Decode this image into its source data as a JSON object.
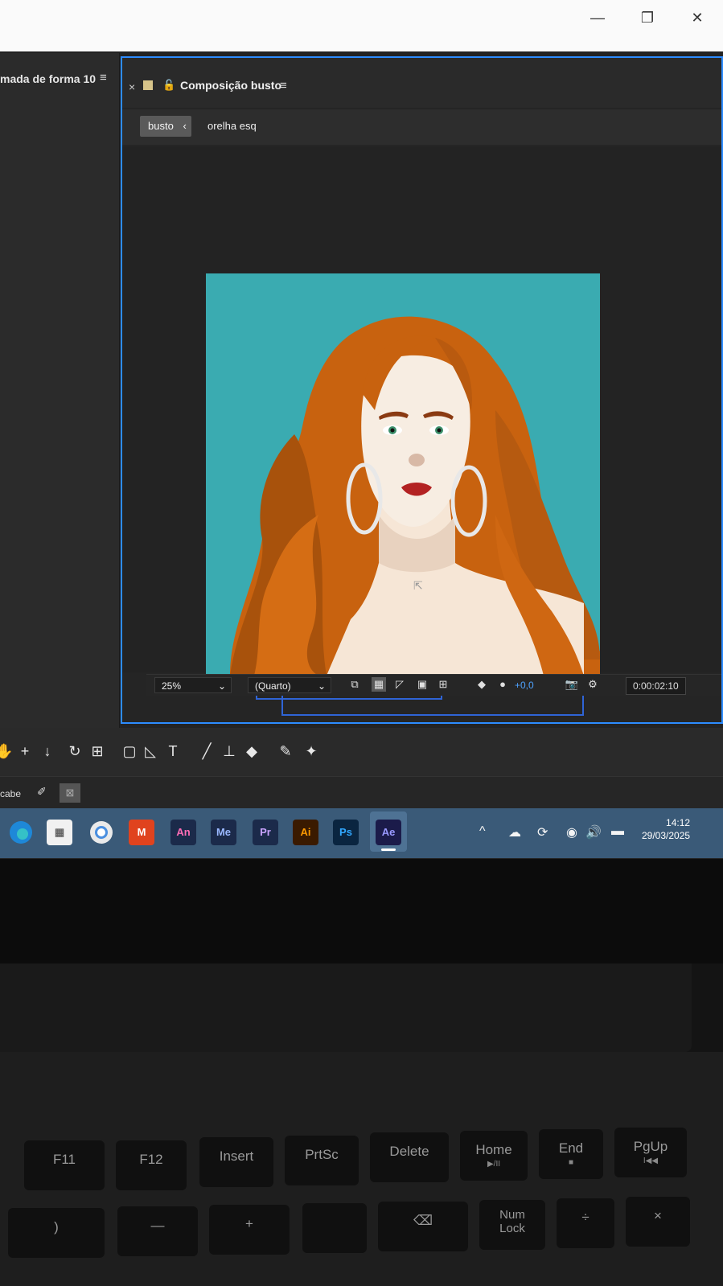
{
  "window": {
    "minimize": "—",
    "restore": "❐",
    "close": "✕"
  },
  "left_panel": {
    "tab_label": "mada de forma 10",
    "menu_icon": "≡"
  },
  "composition": {
    "close": "×",
    "title": "Composição busto",
    "menu_icon": "≡",
    "breadcrumbs": [
      "busto",
      "orelha esq"
    ],
    "breadcrumb_arrow": "‹"
  },
  "viewer_bar": {
    "zoom": "25%",
    "resolution": "(Quarto)",
    "exposure": "+0,0",
    "timecode": "0:00:02:10"
  },
  "tools": {
    "extra_label": "cabe"
  },
  "taskbar": {
    "apps": [
      {
        "name": "Edge",
        "label": "",
        "color": "#1e88d8"
      },
      {
        "name": "Files",
        "label": "",
        "color": "#e9e9e9"
      },
      {
        "name": "Chrome",
        "label": "",
        "color": "#f5f5f5"
      },
      {
        "name": "McAfee",
        "label": "",
        "color": "#c0392b"
      },
      {
        "name": "Animate",
        "label": "An",
        "color": "#1b2a4a"
      },
      {
        "name": "Media Encoder",
        "label": "Me",
        "color": "#1b2a4a"
      },
      {
        "name": "Premiere",
        "label": "Pr",
        "color": "#1b2a4a"
      },
      {
        "name": "Illustrator",
        "label": "Ai",
        "color": "#3a1a00"
      },
      {
        "name": "Photoshop",
        "label": "Ps",
        "color": "#0a2540"
      },
      {
        "name": "After Effects",
        "label": "Ae",
        "color": "#1b1b4a"
      }
    ],
    "time": "14:12",
    "date": "29/03/2025"
  },
  "keyboard": {
    "row1": [
      "F11",
      "F12",
      "Insert",
      "PrtSc",
      "Delete",
      "Home",
      "End",
      "PgUp"
    ],
    "row1_sub": [
      "",
      "",
      "",
      "",
      "",
      "▶/II",
      "■",
      "I◀◀"
    ],
    "row2": [
      ")",
      "—",
      "+",
      "",
      "⌫",
      "Num\nLock",
      "÷",
      "×"
    ]
  }
}
